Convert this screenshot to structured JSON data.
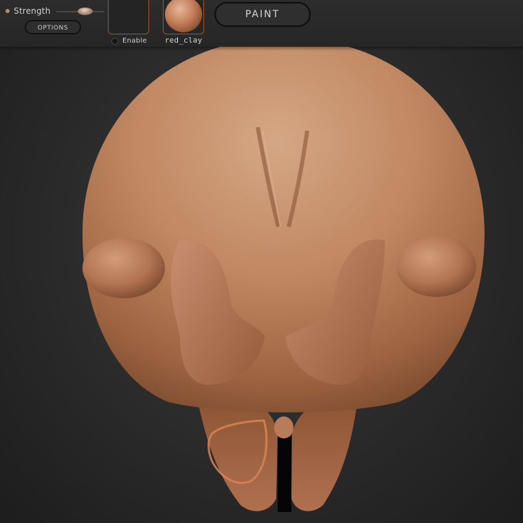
{
  "toolbar": {
    "strength_label": "Strength",
    "strength_value": "",
    "options_label": "OPTIONS",
    "enable_label": "Enable",
    "material_label": "red_clay",
    "paint_label": "PAINT"
  },
  "icons": {
    "strength_dot": "dot-icon",
    "slider": "slider-knob-icon",
    "enable_toggle": "toggle-dot-icon",
    "material_preview": "clay-sphere-icon"
  },
  "colors": {
    "accent": "#a6562f",
    "clay": "#c08863",
    "background": "#2b2b2b"
  }
}
